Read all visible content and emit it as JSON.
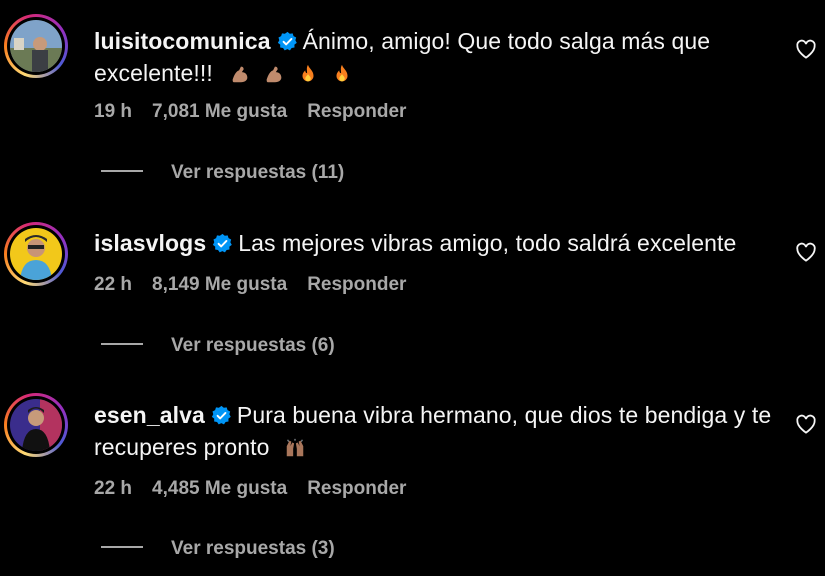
{
  "comments": [
    {
      "username": "luisitocomunica",
      "text": "Ánimo, amigo! Que todo salga más que excelente!!!",
      "emojis": [
        "flexed-biceps-emoji",
        "flexed-biceps-emoji",
        "fire-emoji",
        "fire-emoji"
      ],
      "time": "19 h",
      "likes": "7,081 Me gusta",
      "reply_label": "Responder",
      "view_replies": "Ver respuestas (11)"
    },
    {
      "username": "islasvlogs",
      "text": "Las mejores vibras amigo, todo saldrá excelente",
      "emojis": [],
      "time": "22 h",
      "likes": "8,149 Me gusta",
      "reply_label": "Responder",
      "view_replies": "Ver respuestas (6)"
    },
    {
      "username": "esen_alva",
      "text": "Pura buena vibra hermano, que dios te bendiga y te recuperes pronto",
      "emojis": [
        "raising-hands-emoji"
      ],
      "time": "22 h",
      "likes": "4,485 Me gusta",
      "reply_label": "Responder",
      "view_replies": "Ver respuestas (3)"
    }
  ],
  "colors": {
    "background": "#000000",
    "text": "#f5f5f5",
    "secondary": "#a8a8a8",
    "verified": "#0095f6"
  },
  "icons": {
    "verified": "verified-badge-icon",
    "like": "heart-outline-icon"
  }
}
